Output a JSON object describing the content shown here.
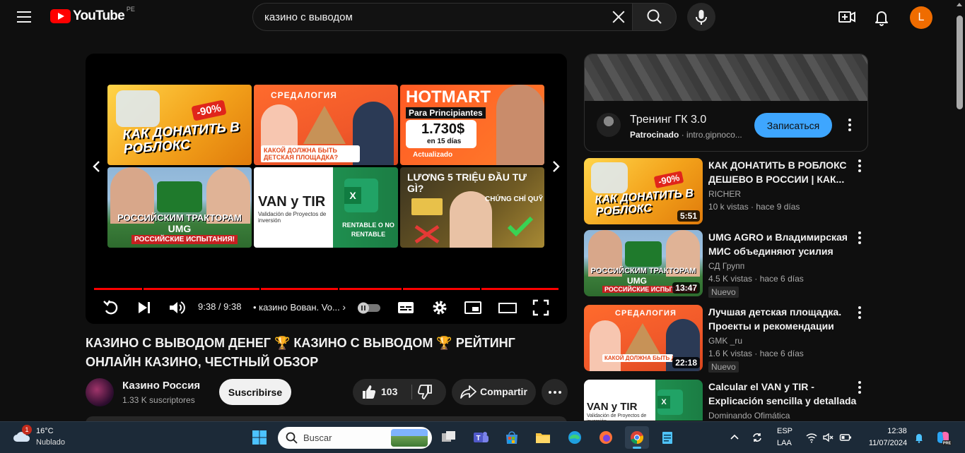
{
  "masthead": {
    "logo_text": "YouTube",
    "country_code": "PE",
    "search_value": "казино с выводом",
    "avatar_letter": "L"
  },
  "player": {
    "time": "9:38 / 9:38",
    "chapter": "• казино Вован. Vo...",
    "endscreen": [
      {
        "text": "КАК ДОНАТИТЬ В РОБЛОКС",
        "badge": "-90%"
      },
      {
        "text": "КАКОЙ ДОЛЖНА БЫТЬ ДЕТСКАЯ ПЛОЩАДКА?",
        "brand": "СРЕДАЛОГИЯ"
      },
      {
        "title": "HOTMART",
        "subtitle": "Para Principiantes",
        "amount": "1.730$",
        "period": "en 15 días",
        "note": "Actualizado"
      },
      {
        "text": "РОССИЙСКИМ ТРАКТОРАМ",
        "brand": "UMG",
        "footer": "РОССИЙСКИЕ ИСПЫТАНИЯ!"
      },
      {
        "title": "VAN y TIR",
        "subtitle": "Validación de Proyectos de inversión",
        "note": "RENTABLE O NO RENTABLE"
      },
      {
        "text": "LƯƠNG 5 TRIỆU ĐẦU TƯ GÌ?",
        "note": "CHỨNG CHỈ QUỸ"
      }
    ]
  },
  "video": {
    "title": "КАЗИНО С ВЫВОДОМ ДЕНЕГ 🏆 КАЗИНО С ВЫВОДОМ 🏆 РЕЙТИНГ ОНЛАЙН КАЗИНО, ЧЕСТНЫЙ ОБЗОР",
    "channel": "Казино Россия",
    "subscribers": "1.33 K suscriptores",
    "subscribe_label": "Suscribirse",
    "likes": "103",
    "share_label": "Compartir"
  },
  "ad": {
    "title": "Тренинг ГК 3.0",
    "sponsored": "Patrocinado",
    "domain": "· intro.gipnoco...",
    "cta": "Записаться"
  },
  "recommendations": [
    {
      "title": "КАК ДОНАТИТЬ В РОБЛОКС ДЕШЕВО В РОССИИ | КАК...",
      "channel": "RICHER",
      "views": "10 k vistas",
      "age": "hace 9 días",
      "duration": "5:51",
      "badge": ""
    },
    {
      "title": "UMG AGRO и Владимирская МИС объединяют усилия дл...",
      "channel": "СД Групп",
      "views": "4.5 K vistas",
      "age": "hace 6 días",
      "duration": "13:47",
      "badge": "Nuevo"
    },
    {
      "title": "Лучшая детская площадка. Проекты и рекомендации по...",
      "channel": "GMK _ru",
      "views": "1.6 K vistas",
      "age": "hace 6 días",
      "duration": "22:18",
      "badge": "Nuevo"
    },
    {
      "title": "Calcular el VAN y TIR - Explicación sencilla y detallada",
      "channel": "Dominando Ofimática",
      "views": "",
      "age": "",
      "duration": "",
      "badge": ""
    }
  ],
  "taskbar": {
    "weather_temp": "16°C",
    "weather_desc": "Nublado",
    "weather_badge": "1",
    "search_placeholder": "Buscar",
    "lang_top": "ESP",
    "lang_bottom": "LAA",
    "time": "12:38",
    "date": "11/07/2024"
  },
  "colors": {
    "background": "#0f0f0f",
    "brand_red": "#ff0000",
    "cta_blue": "#3ea6ff",
    "avatar_orange": "#ef6c00",
    "taskbar": "#1c2a38"
  }
}
